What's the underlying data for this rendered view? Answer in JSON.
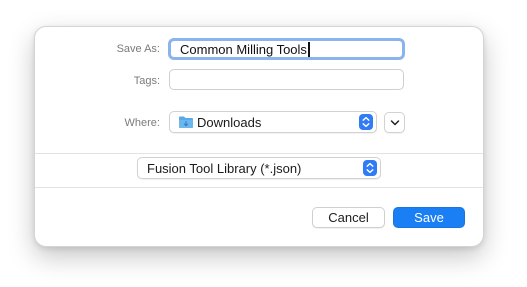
{
  "dialog": {
    "save_as_label": "Save As:",
    "save_as_value": "Common Milling Tools",
    "tags_label": "Tags:",
    "tags_value": "",
    "where_label": "Where:",
    "where_value": "Downloads",
    "format_value": "Fusion Tool Library (*.json)",
    "cancel_label": "Cancel",
    "save_label": "Save"
  },
  "icons": {
    "where_icon": "folder-icon",
    "where_stepper": "up-down-chevron-icon",
    "expand": "chevron-down-icon",
    "format_stepper": "up-down-chevron-icon"
  },
  "colors": {
    "accent": "#1a7ff5",
    "focus_ring": "#8cb4ec",
    "folder": "#5aa9e6"
  }
}
